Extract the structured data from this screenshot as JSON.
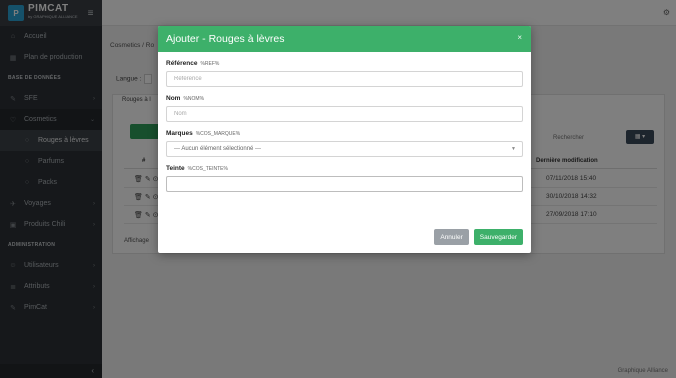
{
  "brand": {
    "name": "PIMCAT",
    "tagline": "by GRAPHIQUE ALLIANCE"
  },
  "sidebar": {
    "items": [
      {
        "label": "Accueil",
        "icon": "home-icon"
      },
      {
        "label": "Plan de production",
        "icon": "calendar-icon"
      }
    ],
    "section_db": "BASE DE DONNÉES",
    "db_items": [
      {
        "label": "SFE",
        "icon": "pencil-icon"
      },
      {
        "label": "Cosmetics",
        "icon": "heart-icon"
      },
      {
        "label": "Rouges à lèvres",
        "sub": true,
        "active": true
      },
      {
        "label": "Parfums",
        "sub": true
      },
      {
        "label": "Packs",
        "sub": true
      },
      {
        "label": "Voyages",
        "icon": "plane-icon"
      },
      {
        "label": "Produits Chili",
        "icon": "box-icon"
      }
    ],
    "section_admin": "ADMINISTRATION",
    "admin_items": [
      {
        "label": "Utilisateurs",
        "icon": "users-icon"
      },
      {
        "label": "Attributs",
        "icon": "tag-icon"
      },
      {
        "label": "PimCat",
        "icon": "pencil-icon"
      }
    ]
  },
  "main": {
    "breadcrumb": "Cosmetics / Ro",
    "lang_label": "Langue :",
    "tab_label": "Rouges à l",
    "search_label": "Rechercher",
    "grid_button": "▦ ▾",
    "col_hash": "#",
    "col_date": "Dernière modification",
    "rows": [
      {
        "actions": "🗑 ✎ ⊙",
        "date": "07/11/2018 15:40"
      },
      {
        "actions": "🗑 ✎ ⊙",
        "date": "30/10/2018 14:32"
      },
      {
        "actions": "🗑 ✎ ⊙",
        "date": "27/09/2018 17:10"
      }
    ],
    "affichage": "Affichage",
    "footer": "Graphique Alliance"
  },
  "modal": {
    "title": "Ajouter - Rouges à lèvres",
    "fields": {
      "reference": {
        "label": "Référence",
        "code": "%REF%",
        "placeholder": "Référence"
      },
      "nom": {
        "label": "Nom",
        "code": "%NOM%",
        "placeholder": "Nom"
      },
      "marques": {
        "label": "Marques",
        "code": "%COS_MARQUE%",
        "value": "--- Aucun élément sélectionné ---"
      },
      "teinte": {
        "label": "Teinte",
        "code": "%COS_TEINTE%",
        "value": ""
      }
    },
    "cancel_label": "Annuler",
    "save_label": "Sauvegarder"
  },
  "colors": {
    "accent": "#3db06a",
    "sidebar": "#2d3136",
    "cancel": "#9aa0a6"
  }
}
